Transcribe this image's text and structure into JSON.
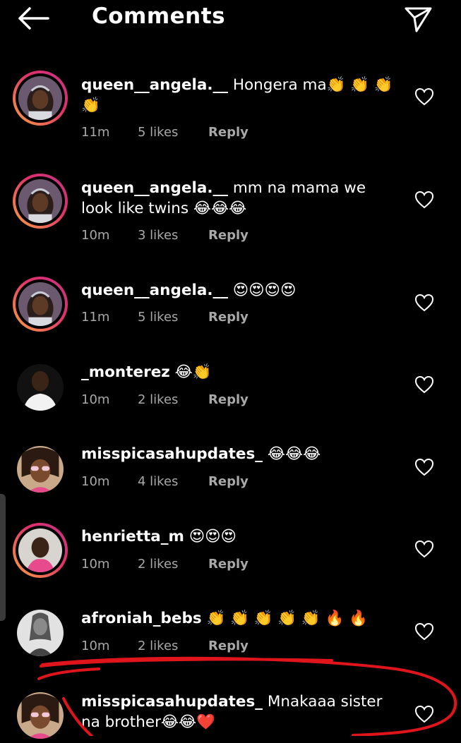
{
  "header": {
    "title": "Comments",
    "back_icon": "arrow-left-icon",
    "send_icon": "paper-plane-icon"
  },
  "comments": [
    {
      "username": "queen__angela.__",
      "text": "Hongera ma👏 👏 👏 👏",
      "time": "11m",
      "likes": "5 likes",
      "reply": "Reply"
    },
    {
      "username": "queen__angela.__",
      "text": "mm na mama we look like twins 😂😂😂",
      "time": "10m",
      "likes": "3 likes",
      "reply": "Reply"
    },
    {
      "username": "queen__angela.__",
      "text": "😍😍😍😍",
      "time": "11m",
      "likes": "5 likes",
      "reply": "Reply"
    },
    {
      "username": "_monterez",
      "text": "😂👏",
      "time": "10m",
      "likes": "2 likes",
      "reply": "Reply"
    },
    {
      "username": "misspicasahupdates_",
      "text": "😂😂😂",
      "time": "10m",
      "likes": "4 likes",
      "reply": "Reply"
    },
    {
      "username": "henrietta_m",
      "text": "😍😍😍",
      "time": "10m",
      "likes": "2 likes",
      "reply": "Reply"
    },
    {
      "username": "afroniah_bebs",
      "text": "👏 👏 👏 👏 👏 🔥 🔥",
      "time": "10m",
      "likes": "2 likes",
      "reply": "Reply"
    },
    {
      "username": "misspicasahupdates_",
      "text": "Mnakaaa sister na brother😂😂❤️"
    }
  ],
  "colors": {
    "background": "#000000",
    "secondary_text": "#a8a8a8",
    "story_ring_start": "#f9a341",
    "story_ring_end": "#c13584",
    "annotation_red": "#e0141b"
  }
}
